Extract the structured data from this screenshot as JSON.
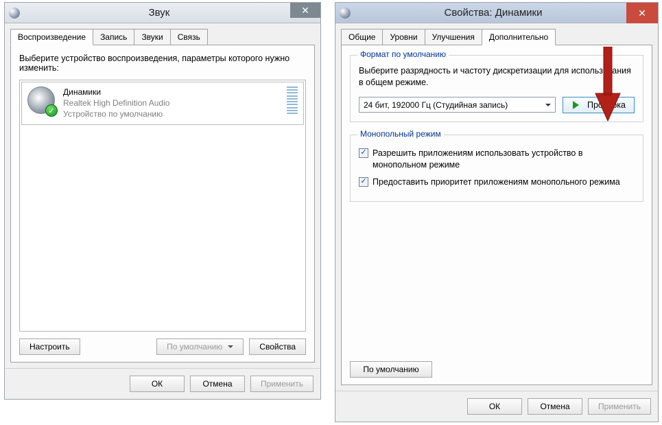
{
  "left": {
    "title": "Звук",
    "tabs": [
      "Воспроизведение",
      "Запись",
      "Звуки",
      "Связь"
    ],
    "active_tab": 0,
    "instruction": "Выберите устройство воспроизведения, параметры которого нужно изменить:",
    "device": {
      "name": "Динамики",
      "driver": "Realtek High Definition Audio",
      "status": "Устройство по умолчанию"
    },
    "buttons": {
      "configure": "Настроить",
      "set_default": "По умолчанию",
      "properties": "Свойства"
    },
    "dlg": {
      "ok": "ОК",
      "cancel": "Отмена",
      "apply": "Применить"
    }
  },
  "right": {
    "title": "Свойства: Динамики",
    "tabs": [
      "Общие",
      "Уровни",
      "Улучшения",
      "Дополнительно"
    ],
    "active_tab": 3,
    "group_format": {
      "title": "Формат по умолчанию",
      "desc": "Выберите разрядность и частоту дискретизации для использования в общем режиме.",
      "selected": "24 бит, 192000 Гц (Студийная запись)",
      "test": "Проверка"
    },
    "group_exclusive": {
      "title": "Монопольный режим",
      "opt1": "Разрешить приложениям использовать устройство в монопольном режиме",
      "opt2": "Предоставить приоритет приложениям монопольного режима"
    },
    "restore_defaults": "По умолчанию",
    "dlg": {
      "ok": "ОК",
      "cancel": "Отмена",
      "apply": "Применить"
    }
  }
}
